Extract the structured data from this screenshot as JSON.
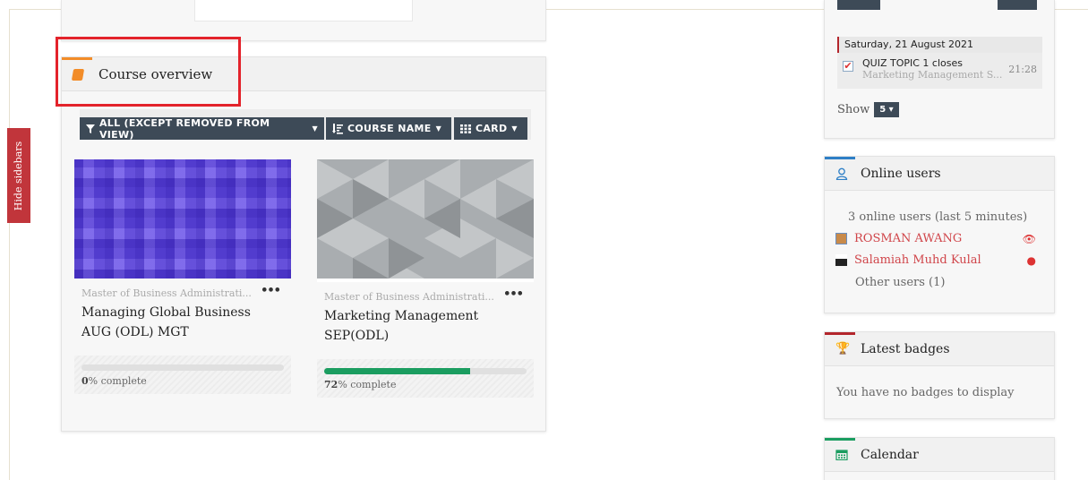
{
  "sidebar_toggle": {
    "label": "Hide sidebars"
  },
  "course_overview": {
    "title": "Course overview",
    "filters": {
      "grouping": "ALL (EXCEPT REMOVED FROM VIEW)",
      "sort": "COURSE NAME",
      "view": "CARD"
    },
    "courses": [
      {
        "category": "Master of Business Administrati...",
        "name_line1": "Managing Global Business",
        "name_line2": "AUG (ODL) MGT",
        "progress": 0,
        "progress_value": "0",
        "progress_suffix": "% complete",
        "image_color": "#6a52e8"
      },
      {
        "category": "Master of Business Administrati...",
        "name_line1": "Marketing Management",
        "name_line2": "SEP(ODL)",
        "progress": 72,
        "progress_value": "72",
        "progress_suffix": "% complete",
        "image_color": "#a9adb0"
      }
    ]
  },
  "timeline": {
    "date": "Saturday, 21 August 2021",
    "event_title": "QUIZ TOPIC 1 closes",
    "event_course": "Marketing Management S...",
    "event_time": "21:28",
    "show_label": "Show",
    "show_value": "5"
  },
  "online_users": {
    "title": "Online users",
    "summary": "3 online users (last 5 minutes)",
    "users": [
      {
        "name": "ROSMAN AWANG",
        "action_icon": "eye-icon"
      },
      {
        "name": "Salamiah Muhd Kulal",
        "action_icon": "message-icon"
      }
    ],
    "other": "Other users (1)"
  },
  "latest_badges": {
    "title": "Latest badges",
    "message": "You have no badges to display"
  },
  "calendar": {
    "title": "Calendar"
  },
  "colors": {
    "accent_orange": "#f28c28",
    "accent_blue": "#2e7fc6",
    "accent_red": "#b3262c",
    "accent_green": "#1b9d60",
    "button_dark": "#3d4a57",
    "highlight": "#e3232b"
  }
}
